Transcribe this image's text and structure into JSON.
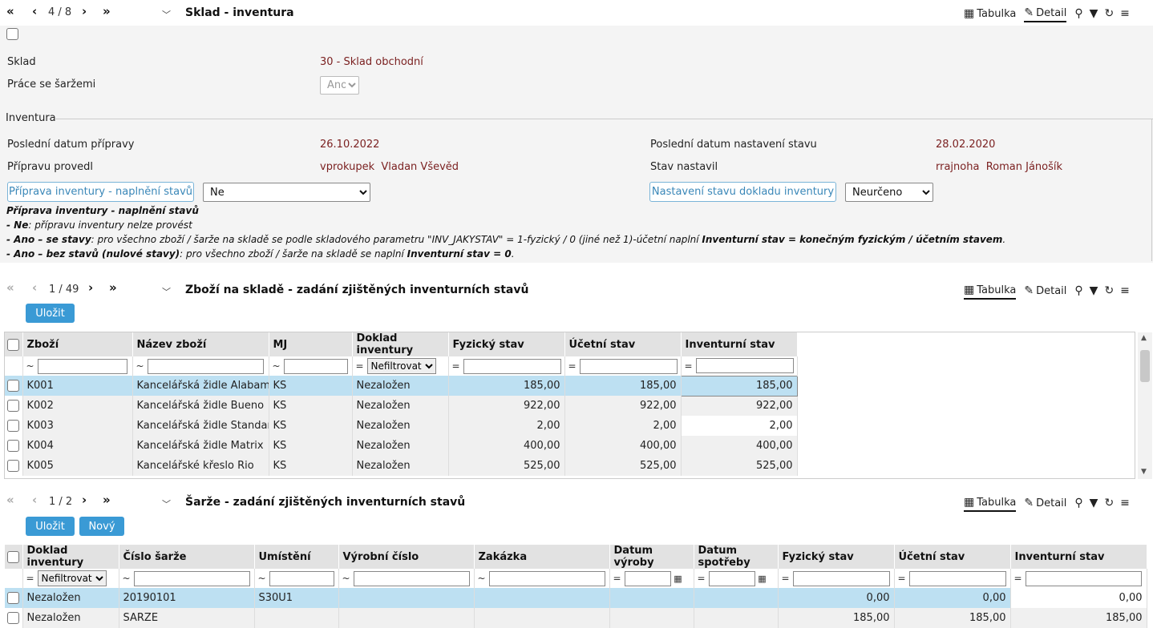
{
  "top": {
    "pager": "4 / 8",
    "title": "Sklad - inventura",
    "tabulka": "Tabulka",
    "detail": "Detail"
  },
  "form": {
    "sklad_label": "Sklad",
    "sklad_value": "30 - Sklad obchodní",
    "sarze_label": "Práce se šaržemi",
    "sarze_value": "Ano",
    "inventura_legend": "Inventura",
    "datum_pripravy_label": "Poslední datum přípravy",
    "datum_pripravy_value": "26.10.2022",
    "pripravu_provedl_label": "Přípravu provedl",
    "pripravu_provedl_value": "vprokupek  Vladan Vševěd",
    "datum_stavu_label": "Poslední datum nastavení stavu",
    "datum_stavu_value": "28.02.2020",
    "stav_nastavil_label": "Stav nastavil",
    "stav_nastavil_value": "rrajnoha  Roman Jánošík",
    "priprava_button": "Příprava inventury - naplnění stavů",
    "priprava_select": "Ne",
    "nastaveni_button": "Nastavení stavu dokladu inventury",
    "nastaveni_select": "Neurčeno"
  },
  "notes": {
    "title": "Příprava inventury - naplnění stavů",
    "line1_b": "- Ne",
    "line1": ": přípravu inventury nelze provést",
    "line2_b": "- Ano – se stavy",
    "line2": ": pro všechno zboží / šarže na skladě se podle skladového parametru \"INV_JAKYSTAV\" = 1-fyzický / 0 (jiné než 1)-účetní naplní ",
    "line2_b2": "Inventurní stav = konečným fyzickým / účetním stavem",
    "line2_end": ".",
    "line3_b": "- Ano – bez stavů (nulové stavy)",
    "line3": ": pro všechno zboží / šarže na skladě se naplní ",
    "line3_b2": "Inventurní stav = 0",
    "line3_end": "."
  },
  "goods": {
    "pager": "1 / 49",
    "title": "Zboží na skladě - zadání zjištěných inventurních stavů",
    "save": "Uložit",
    "tabulka": "Tabulka",
    "detail": "Detail",
    "columns": [
      "Zboží",
      "Název zboží",
      "MJ",
      "Doklad inventury",
      "Fyzický stav",
      "Účetní stav",
      "Inventurní stav"
    ],
    "filter_ops": [
      "~",
      "~",
      "~",
      "=",
      "=",
      "=",
      "="
    ],
    "filter_select": "Nefiltrovat",
    "rows": [
      [
        "K001",
        "Kancelářská židle Alabama",
        "KS",
        "Nezaložen",
        "185,00",
        "185,00",
        "185,00"
      ],
      [
        "K002",
        "Kancelářská židle Bueno",
        "KS",
        "Nezaložen",
        "922,00",
        "922,00",
        "922,00"
      ],
      [
        "K003",
        "Kancelářská židle Standard",
        "KS",
        "Nezaložen",
        "2,00",
        "2,00",
        "2,00"
      ],
      [
        "K004",
        "Kancelářská židle Matrix",
        "KS",
        "Nezaložen",
        "400,00",
        "400,00",
        "400,00"
      ],
      [
        "K005",
        "Kancelářské křeslo Rio",
        "KS",
        "Nezaložen",
        "525,00",
        "525,00",
        "525,00"
      ]
    ]
  },
  "batches": {
    "pager": "1 / 2",
    "title": "Šarže - zadání zjištěných inventurních stavů",
    "save": "Uložit",
    "new": "Nový",
    "tabulka": "Tabulka",
    "detail": "Detail",
    "columns": [
      "Doklad inventury",
      "Číslo šarže",
      "Umístění",
      "Výrobní číslo",
      "Zakázka",
      "Datum výroby",
      "Datum spotřeby",
      "Fyzický stav",
      "Účetní stav",
      "Inventurní stav"
    ],
    "filter_ops": [
      "=",
      "~",
      "~",
      "~",
      "~",
      "=",
      "=",
      "=",
      "=",
      "="
    ],
    "filter_select": "Nefiltrovat",
    "rows": [
      [
        "Nezaložen",
        "20190101",
        "S30U1",
        "",
        "",
        "",
        "",
        "0,00",
        "0,00",
        "0,00"
      ],
      [
        "Nezaložen",
        "SARZE",
        "",
        "",
        "",
        "",
        "",
        "185,00",
        "185,00",
        "185,00"
      ]
    ]
  }
}
